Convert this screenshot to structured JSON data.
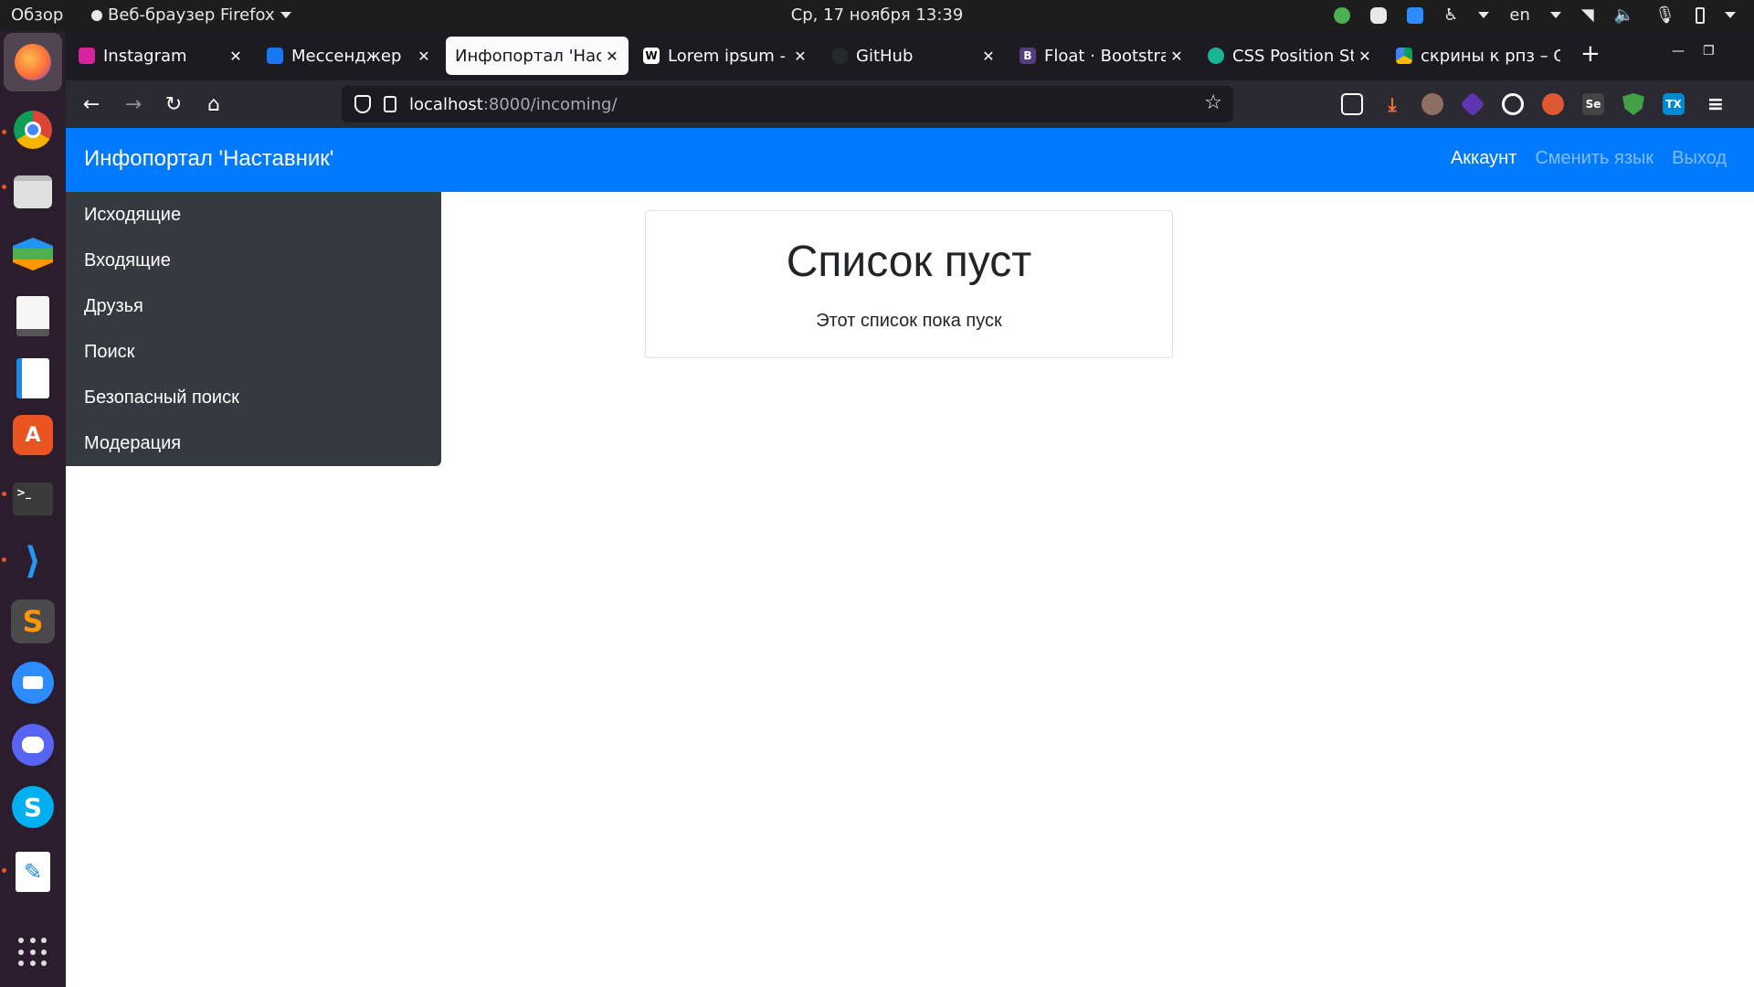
{
  "system": {
    "overview": "Обзор",
    "app_name": "Веб-браузер Firefox",
    "clock": "Ср, 17 ноября  13:39",
    "lang": "en"
  },
  "tabs": [
    {
      "title": "Instagram",
      "icon": "instagram-icon",
      "color": "#d6249f"
    },
    {
      "title": "Мессенджер",
      "icon": "messenger-icon",
      "color": "#1877f2"
    },
    {
      "title": "Инфопортал 'Наставник'",
      "icon": "",
      "color": ""
    },
    {
      "title": "Lorem ipsum - Wikipedia",
      "icon": "wikipedia-icon",
      "color": "#ffffff"
    },
    {
      "title": "GitHub",
      "icon": "github-icon",
      "color": "#24292e"
    },
    {
      "title": "Float · Bootstrap",
      "icon": "bootstrap-icon",
      "color": "#563d7c"
    },
    {
      "title": "CSS Position Sticky",
      "icon": "css-icon",
      "color": "#1ab394"
    },
    {
      "title": "скрины к рпз – Google Диск",
      "icon": "google-drive-icon",
      "color": "#fbbc04"
    }
  ],
  "browser": {
    "url_host": "localhost",
    "url_path": ":8000/incoming/"
  },
  "site": {
    "brand": "Инфопортал 'Наставник'",
    "nav": {
      "account": "Аккаунт",
      "change_language": "Сменить язык",
      "logout": "Выход"
    },
    "sidebar": [
      "Исходящие",
      "Входящие",
      "Друзья",
      "Поиск",
      "Безопасный поиск",
      "Модерация"
    ],
    "empty": {
      "title": "Список пуст",
      "text": "Этот список пока пуск"
    }
  },
  "colors": {
    "primary": "#007bff",
    "sidebar": "#343a40",
    "ubuntu_accent": "#e95420"
  }
}
